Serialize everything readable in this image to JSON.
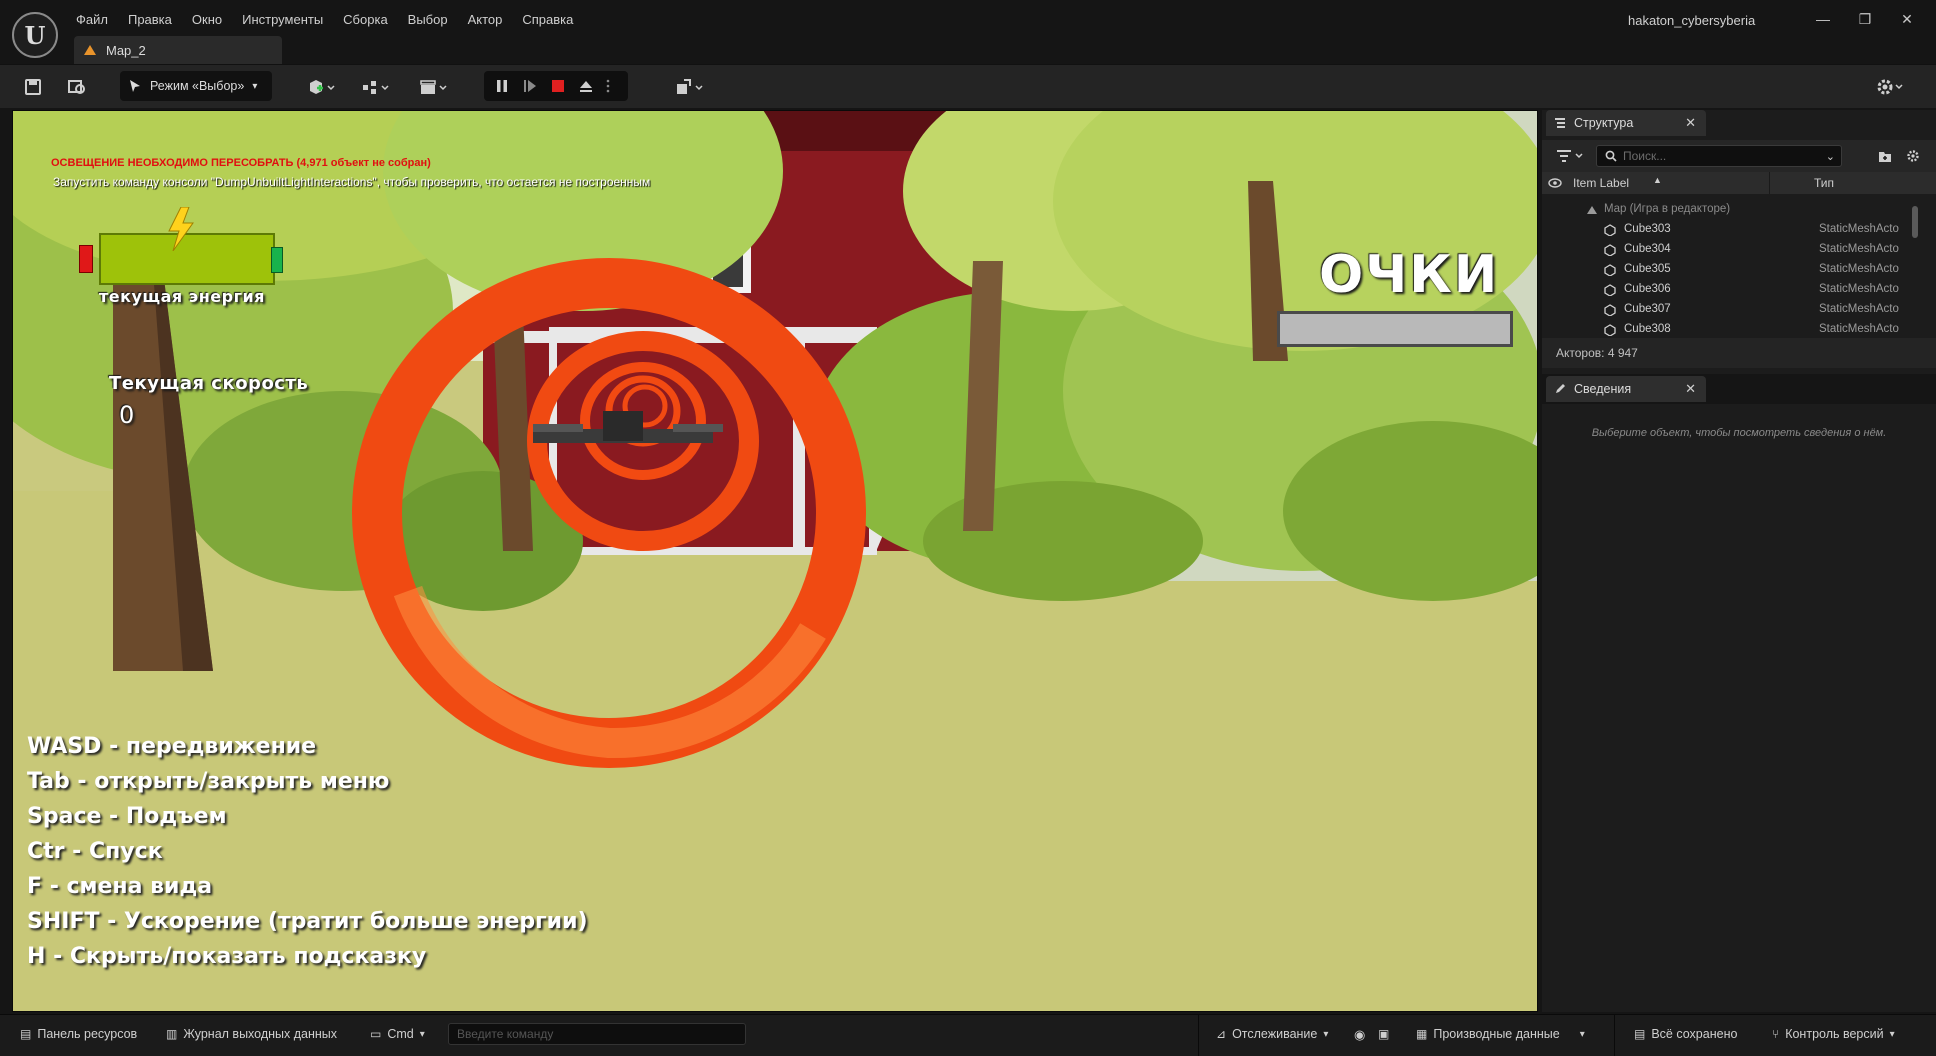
{
  "window": {
    "project_name": "hakaton_cybersyberia",
    "map_tab": "Map_2",
    "minimize": "—",
    "restore": "❐",
    "close": "✕"
  },
  "menu": [
    "Файл",
    "Правка",
    "Окно",
    "Инструменты",
    "Сборка",
    "Выбор",
    "Актор",
    "Справка"
  ],
  "toolbar": {
    "mode_label": "Режим «Выбор»"
  },
  "viewport": {
    "lighting_warning": "ОСВЕЩЕНИЕ НЕОБХОДИМО ПЕРЕСОБРАТЬ (4,971 объект не собран)",
    "lighting_hint": "Запустить команду консоли \"DumpUnbuiltLightInteractions\", чтобы проверить, что остается не построенным",
    "energy_label": "текущая энергия",
    "speed_label": "Текущая скорость",
    "speed_value": "0",
    "score_label": "ОЧКИ",
    "controls": [
      "WASD - передвижение",
      "Tab - открыть/закрыть меню",
      "Space - Подъем",
      "Ctr - Спуск",
      "F - смена вида",
      "SHIFT - Ускорение (тратит больше энергии)",
      "H - Скрыть/показать подсказку"
    ]
  },
  "outliner": {
    "tab_label": "Структура",
    "search_placeholder": "Поиск...",
    "col_label": "Item Label",
    "col_type": "Тип",
    "root": "Map (Игра в редакторе)",
    "rows": [
      {
        "name": "Cube303",
        "type": "StaticMeshActo"
      },
      {
        "name": "Cube304",
        "type": "StaticMeshActo"
      },
      {
        "name": "Cube305",
        "type": "StaticMeshActo"
      },
      {
        "name": "Cube306",
        "type": "StaticMeshActo"
      },
      {
        "name": "Cube307",
        "type": "StaticMeshActo"
      },
      {
        "name": "Cube308",
        "type": "StaticMeshActo"
      }
    ],
    "actors_count": "Акторов: 4 947"
  },
  "details": {
    "tab_label": "Сведения",
    "empty_text": "Выберите объект, чтобы посмотреть сведения о нём."
  },
  "statusbar": {
    "content_drawer": "Панель ресурсов",
    "output_log": "Журнал выходных данных",
    "cmd": "Cmd",
    "cmd_placeholder": "Введите  команду",
    "trace": "Отслеживание",
    "derived_data": "Производные данные",
    "all_saved": "Всё сохранено",
    "source_control": "Контроль версий"
  },
  "colors": {
    "warning_red": "#e01010",
    "energy_green": "#9ec20a",
    "ring_orange": "#f04a12"
  }
}
